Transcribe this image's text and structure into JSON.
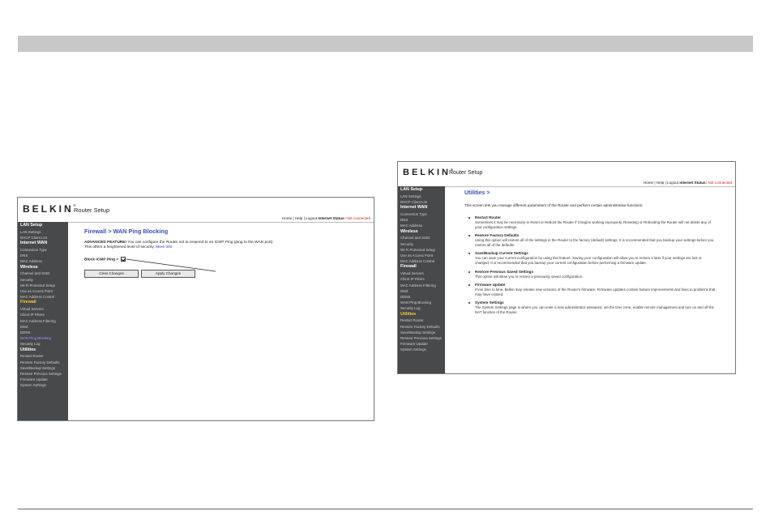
{
  "left": {
    "brand": "BELKIN",
    "reg": "®",
    "title": "Router Setup",
    "status": {
      "links": "Home | Help | Logout",
      "label": "Internet Status:",
      "value": "Not connected"
    },
    "sidebar": [
      {
        "label": "LAN Setup",
        "kind": "section"
      },
      {
        "label": "LAN Settings",
        "kind": "item"
      },
      {
        "label": "DHCP Client List",
        "kind": "item"
      },
      {
        "label": "Internet WAN",
        "kind": "section"
      },
      {
        "label": "Connection Type",
        "kind": "item"
      },
      {
        "label": "DNS",
        "kind": "item"
      },
      {
        "label": "MAC Address",
        "kind": "item"
      },
      {
        "label": "Wireless",
        "kind": "section"
      },
      {
        "label": "Channel and SSID",
        "kind": "item"
      },
      {
        "label": "Security",
        "kind": "item"
      },
      {
        "label": "Wi-Fi Protected Setup",
        "kind": "item"
      },
      {
        "label": "Use as Access Point",
        "kind": "item"
      },
      {
        "label": "MAC Address Control",
        "kind": "item"
      },
      {
        "label": "Firewall",
        "kind": "highlight"
      },
      {
        "label": "Virtual Servers",
        "kind": "item"
      },
      {
        "label": "Client IP Filters",
        "kind": "item"
      },
      {
        "label": "MAC Address Filtering",
        "kind": "item"
      },
      {
        "label": "DMZ",
        "kind": "item"
      },
      {
        "label": "DDNS",
        "kind": "item"
      },
      {
        "label": "WAN Ping Blocking",
        "kind": "current"
      },
      {
        "label": "Security Log",
        "kind": "item"
      },
      {
        "label": "Utilities",
        "kind": "section"
      },
      {
        "label": "Restart Router",
        "kind": "item"
      },
      {
        "label": "Restore Factory Defaults",
        "kind": "item"
      },
      {
        "label": "Save/Backup Settings",
        "kind": "item"
      },
      {
        "label": "Restore Previous Settings",
        "kind": "item"
      },
      {
        "label": "Firmware Update",
        "kind": "item"
      },
      {
        "label": "System Settings",
        "kind": "item"
      }
    ],
    "page_title": "Firewall > WAN Ping Blocking",
    "adv_label": "ADVANCED FEATURE!",
    "adv_text": " You can configure the Router not to respond to an ICMP Ping (ping to the WAN port).",
    "adv_text2": "This offers a heightened level of security.",
    "more_info": "More Info",
    "block_label": "Block ICMP Ping >",
    "block_checked": true,
    "clear_button": "Clear Changes",
    "apply_button": "Apply Changes"
  },
  "right": {
    "brand": "BELKIN",
    "reg": "®",
    "title": "Router Setup",
    "status": {
      "links": "Home | Help | Logout",
      "label": "Internet Status:",
      "value": "Not connected"
    },
    "sidebar": [
      {
        "label": "LAN Setup",
        "kind": "section"
      },
      {
        "label": "LAN Settings",
        "kind": "item"
      },
      {
        "label": "DHCP Client List",
        "kind": "item"
      },
      {
        "label": "Internet WAN",
        "kind": "section"
      },
      {
        "label": "Connection Type",
        "kind": "item"
      },
      {
        "label": "DNS",
        "kind": "item"
      },
      {
        "label": "MAC Address",
        "kind": "item"
      },
      {
        "label": "Wireless",
        "kind": "section"
      },
      {
        "label": "Channel and SSID",
        "kind": "item"
      },
      {
        "label": "Security",
        "kind": "item"
      },
      {
        "label": "Wi-Fi Protected Setup",
        "kind": "item"
      },
      {
        "label": "Use as Access Point",
        "kind": "item"
      },
      {
        "label": "MAC Address Control",
        "kind": "item"
      },
      {
        "label": "Firewall",
        "kind": "section"
      },
      {
        "label": "Virtual Servers",
        "kind": "item"
      },
      {
        "label": "Client IP Filters",
        "kind": "item"
      },
      {
        "label": "MAC Address Filtering",
        "kind": "item"
      },
      {
        "label": "DMZ",
        "kind": "item"
      },
      {
        "label": "DDNS",
        "kind": "item"
      },
      {
        "label": "WAN Ping Blocking",
        "kind": "item"
      },
      {
        "label": "Security Log",
        "kind": "item"
      },
      {
        "label": "Utilities",
        "kind": "highlight"
      },
      {
        "label": "Restart Router",
        "kind": "item"
      },
      {
        "label": "Restore Factory Defaults",
        "kind": "item"
      },
      {
        "label": "Save/Backup Settings",
        "kind": "item"
      },
      {
        "label": "Restore Previous Settings",
        "kind": "item"
      },
      {
        "label": "Firmware Update",
        "kind": "item"
      },
      {
        "label": "System Settings",
        "kind": "item"
      }
    ],
    "page_title": "Utilities >",
    "intro": "This screen lets you manage different parameters of the Router and perform certain administrative functions.",
    "items": [
      {
        "title": "Restart Router",
        "desc": "Sometimes it may be necessary to Reset or Reboot the Router if it begins working improperly. Resetting or Rebooting the Router will not delete any of your configuration settings."
      },
      {
        "title": "Restore Factory Defaults",
        "desc": "Using this option will restore all of the settings in the Router to the factory (default) settings. It is recommended that you backup your settings before you restore all of the defaults."
      },
      {
        "title": "Save/Backup Current Settings",
        "desc": "You can save your current configuration by using this feature. Saving your configuration will allow you to restore it later if your settings are lost or changed. It is recommended that you backup your current configuration before performing a firmware update."
      },
      {
        "title": "Restore Previous Saved Settings",
        "desc": "This option will allow you to restore a previously saved configuration."
      },
      {
        "title": "Firmware Update",
        "desc": "From time to time, Belkin may release new versions of the Router's firmware. Firmware updates contain feature improvements and fixes to problems that may have existed."
      },
      {
        "title": "System Settings",
        "desc": "The System Settings page is where you can enter a new administrator password, set the time zone, enable remote management and turn on and off the NAT function of the Router."
      }
    ]
  },
  "colors": {
    "sidebar_bg": "#47494b",
    "title_blue": "#3a4dbb",
    "status_red": "#d41a1a",
    "highlight": "#ffcc33"
  }
}
